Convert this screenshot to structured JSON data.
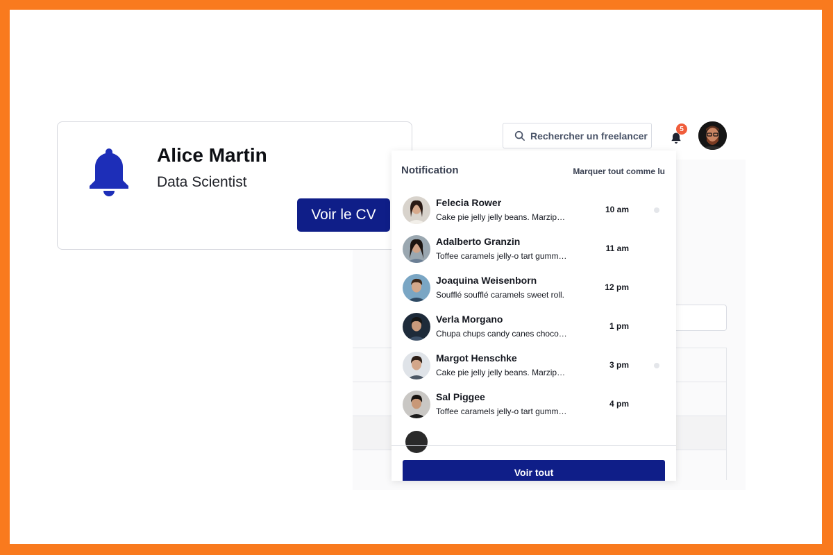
{
  "colors": {
    "frame": "#F97A1E",
    "primary_button": "#0F1E88",
    "bell_icon": "#1D2EB8",
    "badge": "#F05D3B"
  },
  "topbar": {
    "search_label": "Rechercher un freelancer",
    "notification_count": "5"
  },
  "card": {
    "name": "Alice Martin",
    "role": "Data Scientist",
    "cv_button": "Voir le CV"
  },
  "notifications": {
    "title": "Notification",
    "mark_all": "Marquer tout comme lu",
    "see_all": "Voir tout",
    "items": [
      {
        "name": "Felecia Rower",
        "preview": "Cake pie jelly jelly beans. Marzipan lemon drops halvah.",
        "time": "10 am",
        "unread": true
      },
      {
        "name": "Adalberto Granzin",
        "preview": "Toffee caramels jelly-o tart gummi bears.",
        "time": "11 am",
        "unread": false
      },
      {
        "name": "Joaquina Weisenborn",
        "preview": "Soufflé soufflé caramels sweet roll.",
        "time": "12 pm",
        "unread": false
      },
      {
        "name": "Verla Morgano",
        "preview": "Chupa chups candy canes chocolate bar.",
        "time": "1 pm",
        "unread": false
      },
      {
        "name": "Margot Henschke",
        "preview": "Cake pie jelly jelly beans. Marzipan lemon drops halvah.",
        "time": "3 pm",
        "unread": true
      },
      {
        "name": "Sal Piggee",
        "preview": "Toffee caramels jelly-o tart gummi bears.",
        "time": "4 pm",
        "unread": false
      }
    ]
  }
}
